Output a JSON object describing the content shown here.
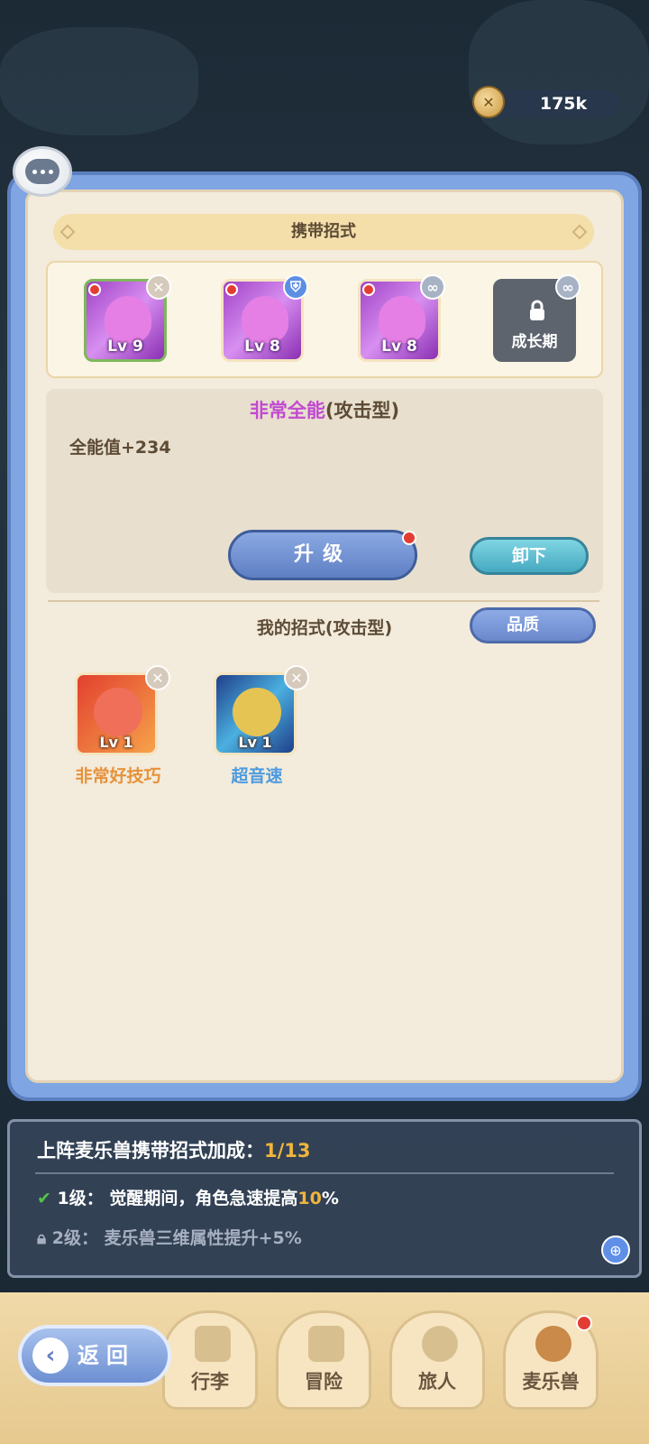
{
  "currency": {
    "amount": "175k",
    "icon": "coin-icon"
  },
  "panel": {
    "title": "携带招式",
    "slots": [
      {
        "level": "Lv 9",
        "badge": "✕",
        "selected": true
      },
      {
        "level": "Lv 8",
        "badge": "⛨",
        "selected": false
      },
      {
        "level": "Lv 8",
        "badge": "∞",
        "selected": false
      },
      {
        "locked_label": "成长期",
        "badge": "∞"
      }
    ],
    "detail": {
      "name": "非常全能",
      "type": "(攻击型)",
      "stat": "全能值+234",
      "upgrade_label": "升级",
      "unload_label": "卸下"
    },
    "my_moves": {
      "title": "我的招式(攻击型)",
      "filter_label": "品质",
      "items": [
        {
          "level": "Lv 1",
          "name": "非常好技巧",
          "name_color": "#e6923a"
        },
        {
          "level": "Lv 1",
          "name": "超音速",
          "name_color": "#4d9be0"
        }
      ]
    }
  },
  "bonus": {
    "title": "上阵麦乐兽携带招式加成：",
    "progress": "1/13",
    "row1_prefix": "1级：  觉醒期间，角色急速提高",
    "row1_value": "10",
    "row1_suffix": "%",
    "row2": "2级：  麦乐兽三维属性提升+5%"
  },
  "nav": {
    "back_label": "返回",
    "items": [
      {
        "label": "行李"
      },
      {
        "label": "冒险"
      },
      {
        "label": "旅人"
      },
      {
        "label": "麦乐兽"
      }
    ]
  }
}
